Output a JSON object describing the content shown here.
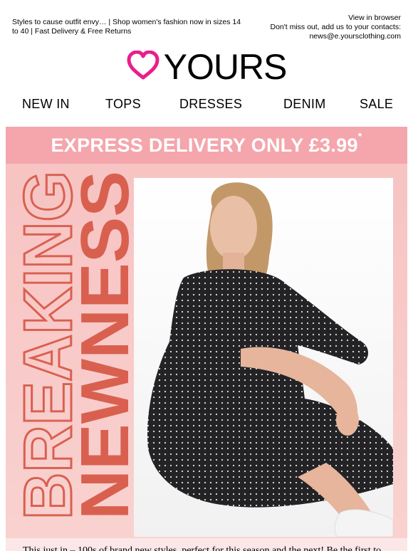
{
  "preheader": {
    "text": "Styles to cause outfit envy… | Shop women's fashion now in sizes 14 to 40 | Fast Delivery & Free Returns"
  },
  "topright": {
    "view_in_browser": "View in browser",
    "dont_miss_out": "Don't miss out, add us to your contacts:",
    "email": "news@e.yoursclothing.com"
  },
  "brand": {
    "logo_text": "YOURS",
    "logo_color": "#e91e8c"
  },
  "nav": {
    "items": [
      "NEW IN",
      "TOPS",
      "DRESSES",
      "DENIM",
      "SALE"
    ]
  },
  "banner": {
    "text": "EXPRESS DELIVERY ONLY £3.99",
    "asterisk": "*",
    "background": "#f4a6ac"
  },
  "hero": {
    "headline_outline": "BREAKING",
    "headline_solid": "NEWNESS",
    "headline_color": "#d9604f",
    "background": "#f7c3c3"
  },
  "body_text": "This just in – 100s of brand new styles, perfect for this season and the next! Be the first to"
}
